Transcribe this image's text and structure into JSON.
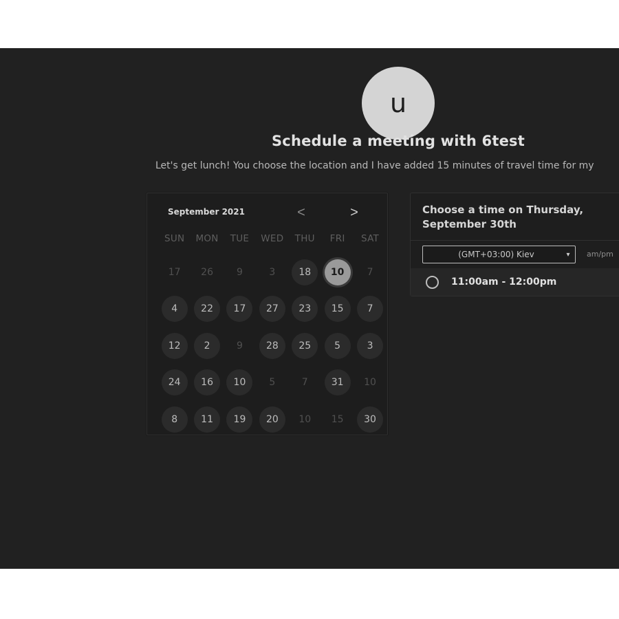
{
  "host": {
    "avatar_initial": "u",
    "title": "Schedule a meeting with 6test",
    "description": "Let's get lunch! You choose the location and I have added 15 minutes of travel time for my"
  },
  "calendar": {
    "month_label": "September 2021",
    "prev_icon": "chevron-left-icon",
    "next_icon": "chevron-right-icon",
    "prev_glyph": "<",
    "next_glyph": ">",
    "weekdays": [
      "SUN",
      "MON",
      "TUE",
      "WED",
      "THU",
      "FRI",
      "SAT"
    ],
    "weeks": [
      [
        {
          "label": "17",
          "state": "disabled"
        },
        {
          "label": "26",
          "state": "disabled"
        },
        {
          "label": "9",
          "state": "disabled"
        },
        {
          "label": "3",
          "state": "disabled"
        },
        {
          "label": "18",
          "state": "available"
        },
        {
          "label": "10",
          "state": "selected"
        },
        {
          "label": "7",
          "state": "disabled"
        }
      ],
      [
        {
          "label": "4",
          "state": "available"
        },
        {
          "label": "22",
          "state": "available"
        },
        {
          "label": "17",
          "state": "available"
        },
        {
          "label": "27",
          "state": "available"
        },
        {
          "label": "23",
          "state": "available"
        },
        {
          "label": "15",
          "state": "available"
        },
        {
          "label": "7",
          "state": "available"
        }
      ],
      [
        {
          "label": "12",
          "state": "available"
        },
        {
          "label": "2",
          "state": "available"
        },
        {
          "label": "9",
          "state": "disabled"
        },
        {
          "label": "28",
          "state": "available"
        },
        {
          "label": "25",
          "state": "available"
        },
        {
          "label": "5",
          "state": "available"
        },
        {
          "label": "3",
          "state": "available"
        }
      ],
      [
        {
          "label": "24",
          "state": "available"
        },
        {
          "label": "16",
          "state": "available"
        },
        {
          "label": "10",
          "state": "available"
        },
        {
          "label": "5",
          "state": "disabled"
        },
        {
          "label": "7",
          "state": "disabled"
        },
        {
          "label": "31",
          "state": "available"
        },
        {
          "label": "10",
          "state": "disabled"
        }
      ],
      [
        {
          "label": "8",
          "state": "available"
        },
        {
          "label": "11",
          "state": "available"
        },
        {
          "label": "19",
          "state": "available"
        },
        {
          "label": "20",
          "state": "available"
        },
        {
          "label": "10",
          "state": "disabled"
        },
        {
          "label": "15",
          "state": "disabled"
        },
        {
          "label": "30",
          "state": "available"
        }
      ]
    ]
  },
  "time_panel": {
    "heading": "Choose a time on Thursday, September 30th",
    "timezone": "(GMT+03:00) Kiev",
    "timezone_caret_icon": "caret-down-icon",
    "format_toggle": "am/pm",
    "slots": [
      {
        "label": "11:00am - 12:00pm",
        "selected": false
      }
    ]
  },
  "colors": {
    "page_background": "#212121",
    "selected_day": "#9a9a9a",
    "available_day": "#2b2b2b"
  }
}
